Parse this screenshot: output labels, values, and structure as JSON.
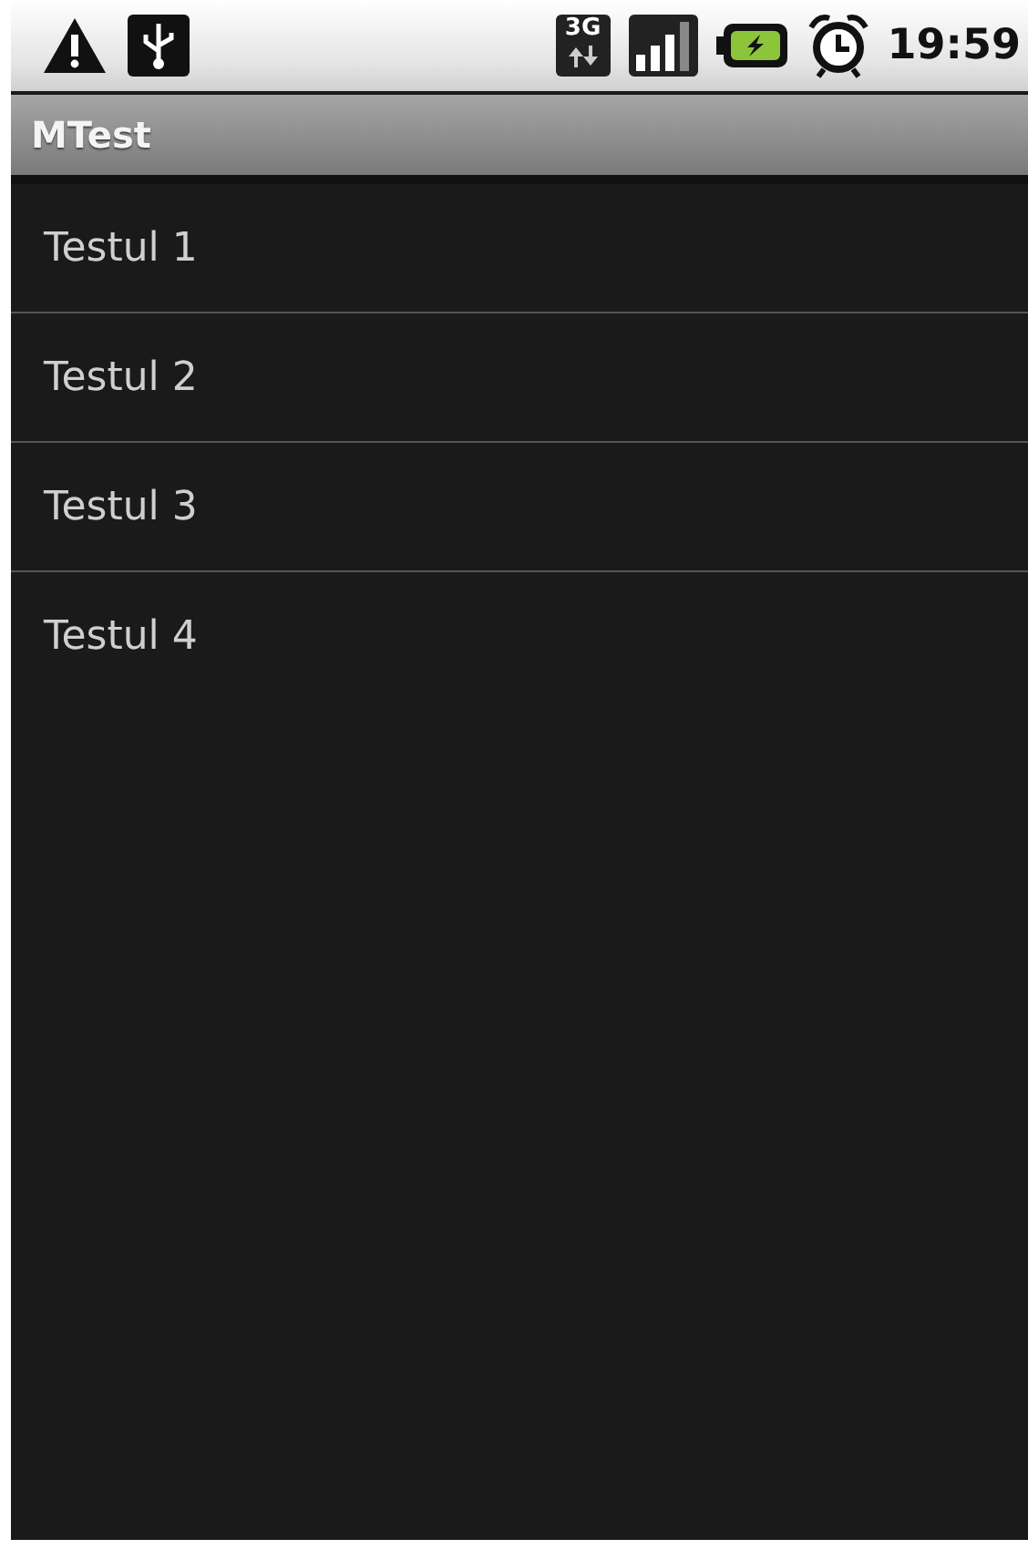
{
  "status_bar": {
    "network_type": "3G",
    "time": "19:59"
  },
  "title_bar": {
    "title": "MTest"
  },
  "list": {
    "items": [
      {
        "label": "Testul 1"
      },
      {
        "label": "Testul 2"
      },
      {
        "label": "Testul 3"
      },
      {
        "label": "Testul 4"
      }
    ]
  }
}
